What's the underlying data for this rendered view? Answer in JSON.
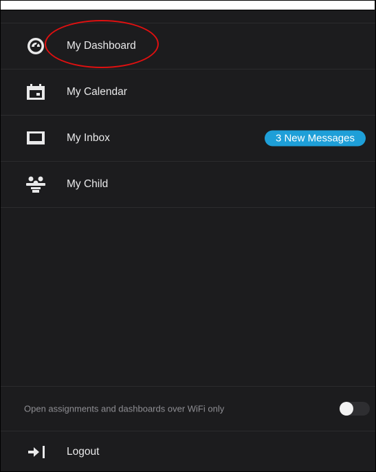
{
  "menu": {
    "items": [
      {
        "label": "My Dashboard",
        "icon": "dashboard-gauge-icon"
      },
      {
        "label": "My Calendar",
        "icon": "calendar-icon"
      },
      {
        "label": "My Inbox",
        "icon": "inbox-icon",
        "badge": "3 New Messages"
      },
      {
        "label": "My Child",
        "icon": "people-icon"
      }
    ]
  },
  "settings": {
    "wifi_only_label": "Open assignments and dashboards over WiFi only",
    "wifi_only_enabled": false
  },
  "logout": {
    "label": "Logout",
    "icon": "logout-arrow-icon"
  },
  "colors": {
    "background": "#1c1c1e",
    "badge": "#1e9fd8",
    "highlight_annotation": "#e01010",
    "text": "#e9e9ea",
    "muted_text": "#8e8e93"
  }
}
